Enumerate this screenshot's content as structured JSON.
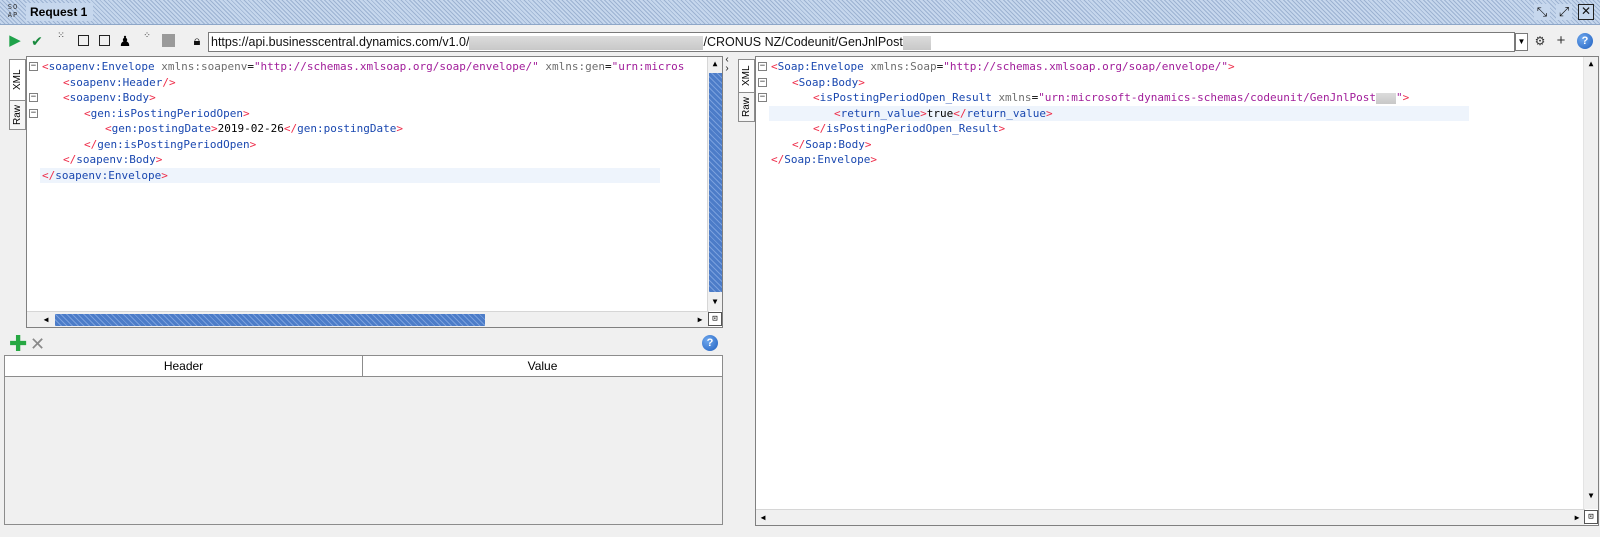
{
  "window": {
    "logo": "SO AP",
    "title": "Request 1"
  },
  "toolbar": {
    "url_prefix": "https://api.businesscentral.dynamics.com/v1.0/",
    "url_suffix": "/CRONUS NZ/Codeunit/GenJnlPost",
    "icons": [
      "play-icon",
      "check-icon",
      "toggle-icon",
      "frame-icon",
      "checkbox-icon",
      "user-icon",
      "options-icon",
      "stop-icon",
      "lock-icon",
      "dropdown-icon",
      "settings-icon",
      "add-icon",
      "help-icon"
    ]
  },
  "request": {
    "tabs": {
      "xml": "XML",
      "raw": "Raw"
    },
    "lines": [
      {
        "indent": 0,
        "parts": [
          [
            "br",
            "<"
          ],
          [
            "tag",
            "soapenv:Envelope"
          ],
          [
            "txt",
            " "
          ],
          [
            "attr",
            "xmlns:soapenv"
          ],
          [
            "txt",
            "="
          ],
          [
            "val",
            "\"http://schemas.xmlsoap.org/soap/envelope/\""
          ],
          [
            "txt",
            " "
          ],
          [
            "attr",
            "xmlns:gen"
          ],
          [
            "txt",
            "="
          ],
          [
            "val",
            "\"urn:micros"
          ]
        ]
      },
      {
        "indent": 1,
        "parts": [
          [
            "br",
            "<"
          ],
          [
            "tag",
            "soapenv:Header"
          ],
          [
            "br",
            "/>"
          ]
        ]
      },
      {
        "indent": 1,
        "parts": [
          [
            "br",
            "<"
          ],
          [
            "tag",
            "soapenv:Body"
          ],
          [
            "br",
            ">"
          ]
        ]
      },
      {
        "indent": 2,
        "parts": [
          [
            "br",
            "<"
          ],
          [
            "tag",
            "gen:isPostingPeriodOpen"
          ],
          [
            "br",
            ">"
          ]
        ]
      },
      {
        "indent": 3,
        "parts": [
          [
            "br",
            "<"
          ],
          [
            "tag",
            "gen:postingDate"
          ],
          [
            "br",
            ">"
          ],
          [
            "txt",
            "2019-02-26"
          ],
          [
            "br",
            "</"
          ],
          [
            "tag",
            "gen:postingDate"
          ],
          [
            "br",
            ">"
          ]
        ]
      },
      {
        "indent": 2,
        "parts": [
          [
            "br",
            "</"
          ],
          [
            "tag",
            "gen:isPostingPeriodOpen"
          ],
          [
            "br",
            ">"
          ]
        ]
      },
      {
        "indent": 1,
        "parts": [
          [
            "br",
            "</"
          ],
          [
            "tag",
            "soapenv:Body"
          ],
          [
            "br",
            ">"
          ]
        ]
      },
      {
        "indent": 0,
        "parts": [
          [
            "br",
            "</"
          ],
          [
            "tag",
            "soapenv:Envelope"
          ],
          [
            "br",
            ">"
          ]
        ]
      }
    ]
  },
  "headers": {
    "columns": [
      "Header",
      "Value"
    ]
  },
  "response": {
    "tabs": {
      "xml": "XML",
      "raw": "Raw"
    },
    "lines": [
      {
        "indent": 0,
        "parts": [
          [
            "br",
            "<"
          ],
          [
            "tag",
            "Soap:Envelope"
          ],
          [
            "txt",
            " "
          ],
          [
            "attr",
            "xmlns:Soap"
          ],
          [
            "txt",
            "="
          ],
          [
            "val",
            "\"http://schemas.xmlsoap.org/soap/envelope/\""
          ],
          [
            "br",
            ">"
          ]
        ]
      },
      {
        "indent": 1,
        "parts": [
          [
            "br",
            "<"
          ],
          [
            "tag",
            "Soap:Body"
          ],
          [
            "br",
            ">"
          ]
        ]
      },
      {
        "indent": 2,
        "parts": [
          [
            "br",
            "<"
          ],
          [
            "tag",
            "isPostingPeriodOpen_Result"
          ],
          [
            "txt",
            " "
          ],
          [
            "attr",
            "xmlns"
          ],
          [
            "txt",
            "="
          ],
          [
            "val",
            "\"urn:microsoft-dynamics-schemas/codeunit/GenJnlPost"
          ],
          [
            "redact",
            ""
          ],
          [
            "val",
            "\""
          ],
          [
            "br",
            ">"
          ]
        ]
      },
      {
        "indent": 3,
        "parts": [
          [
            "br",
            "<"
          ],
          [
            "tag",
            "return_value"
          ],
          [
            "br",
            ">"
          ],
          [
            "txt",
            "true"
          ],
          [
            "br",
            "</"
          ],
          [
            "tag",
            "return_value"
          ],
          [
            "br",
            ">"
          ]
        ]
      },
      {
        "indent": 2,
        "parts": [
          [
            "br",
            "</"
          ],
          [
            "tag",
            "isPostingPeriodOpen_Result"
          ],
          [
            "br",
            ">"
          ]
        ]
      },
      {
        "indent": 1,
        "parts": [
          [
            "br",
            "</"
          ],
          [
            "tag",
            "Soap:Body"
          ],
          [
            "br",
            ">"
          ]
        ]
      },
      {
        "indent": 0,
        "parts": [
          [
            "br",
            "</"
          ],
          [
            "tag",
            "Soap:Envelope"
          ],
          [
            "br",
            ">"
          ]
        ]
      }
    ]
  }
}
